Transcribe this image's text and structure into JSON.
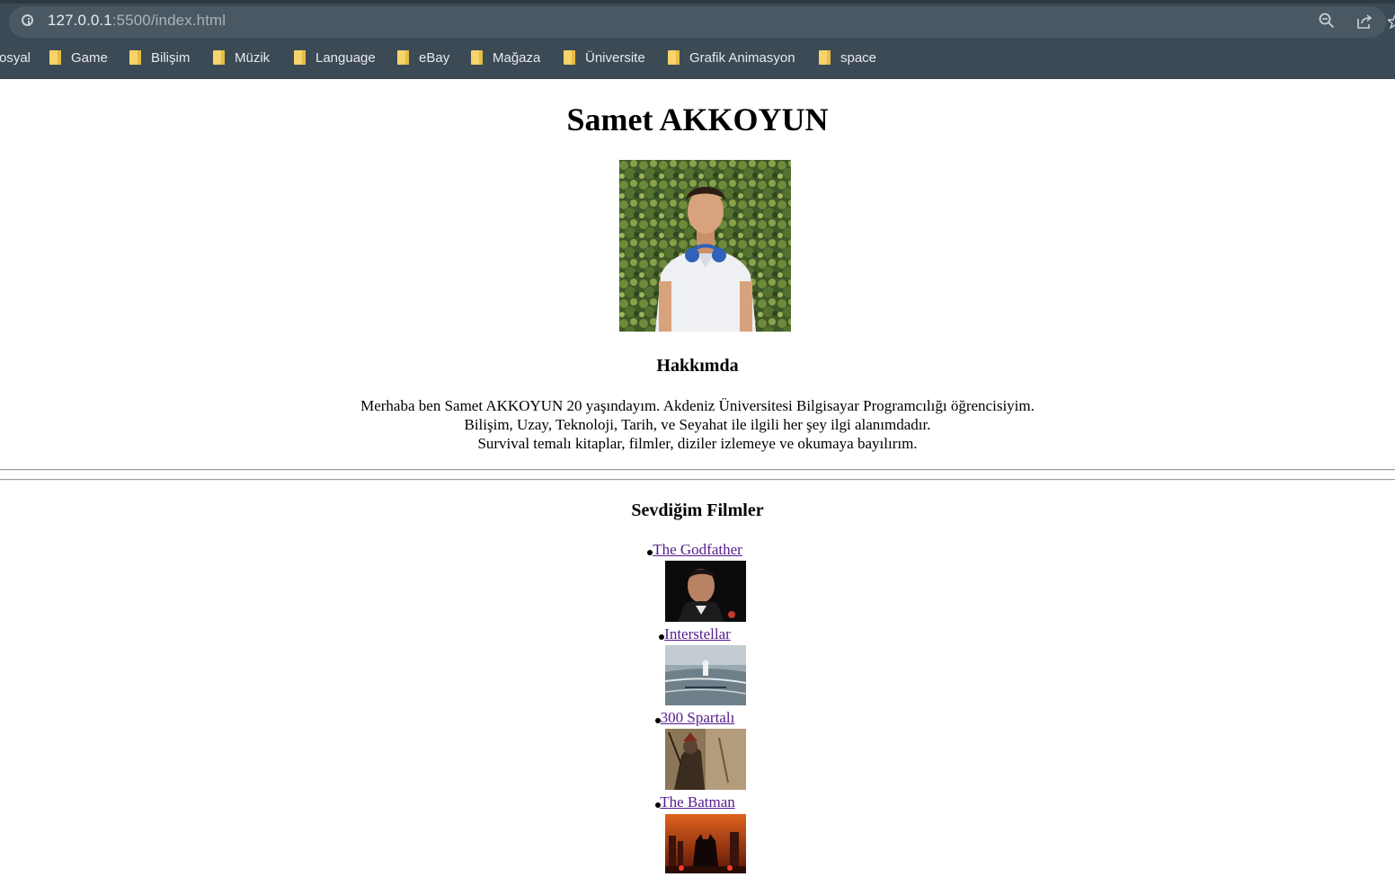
{
  "browser": {
    "url_host": "127.0.0.1",
    "url_rest": ":5500/index.html",
    "bookmarks": [
      {
        "label": "osyal"
      },
      {
        "label": "Game"
      },
      {
        "label": "Bilişim"
      },
      {
        "label": "Müzik"
      },
      {
        "label": "Language"
      },
      {
        "label": "eBay"
      },
      {
        "label": "Mağaza"
      },
      {
        "label": "Üniversite"
      },
      {
        "label": "Grafik Animasyon"
      },
      {
        "label": "space"
      }
    ]
  },
  "page": {
    "title": "Samet AKKOYUN",
    "about": {
      "heading": "Hakkımda",
      "lines": [
        "Merhaba ben Samet AKKOYUN 20 yaşındayım. Akdeniz Üniversitesi Bilgisayar Programcılığı öğrencisiyim.",
        "Bilişim, Uzay, Teknoloji, Tarih, ve Seyahat ile ilgili her şey ilgi alanımdadır.",
        "Survival temalı kitaplar, filmler, diziler izlemeye ve okumaya bayılırım."
      ]
    },
    "films": {
      "heading": "Sevdiğim Filmler",
      "items": [
        {
          "title": "The Godfather"
        },
        {
          "title": "Interstellar"
        },
        {
          "title": "300 Spartalı"
        },
        {
          "title": "The Batman"
        }
      ]
    }
  },
  "colors": {
    "chrome_bg": "#3c4a55",
    "link_visited": "#551a8b",
    "folder": "#f6d46b"
  }
}
